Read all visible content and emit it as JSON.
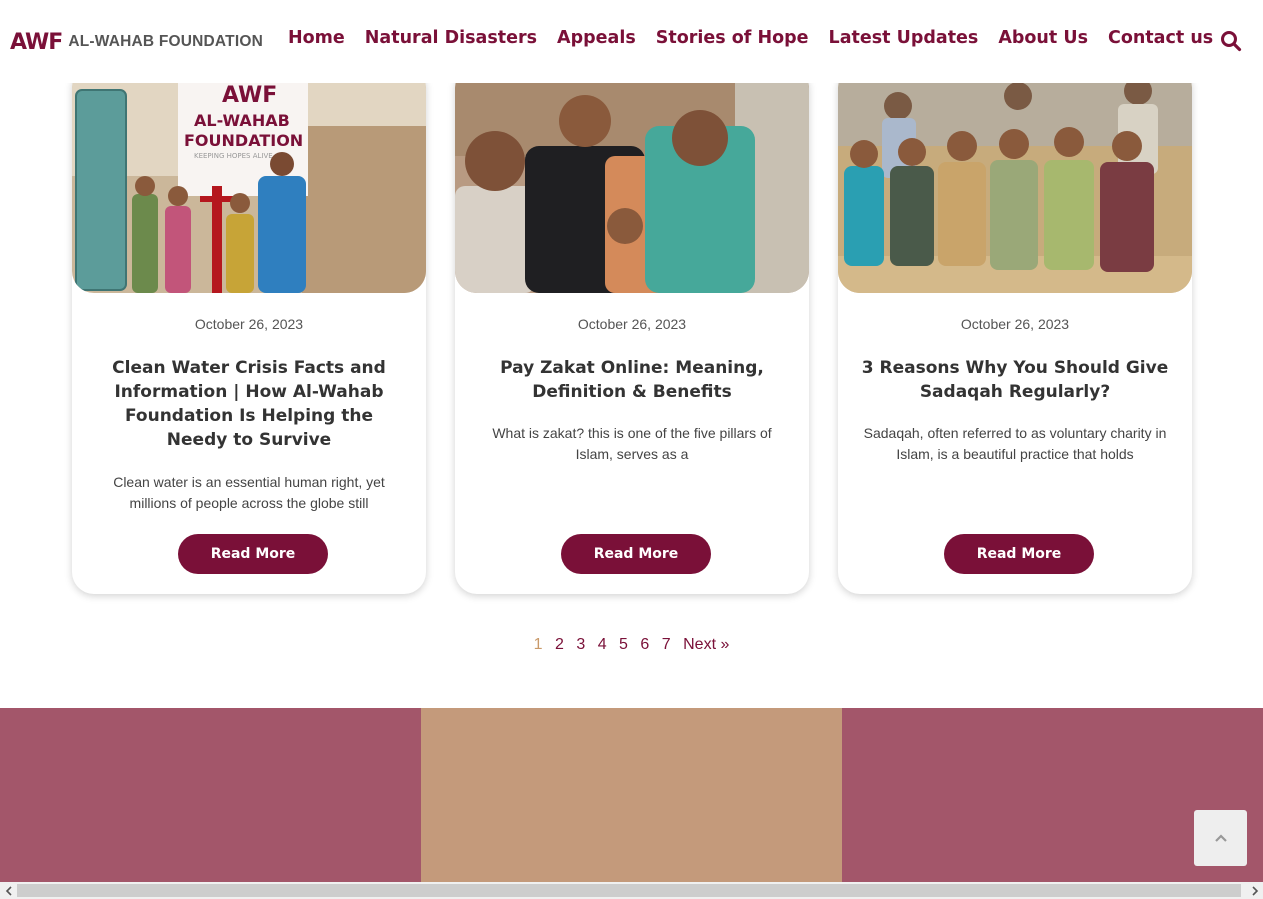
{
  "header": {
    "logo_mark": "AWF",
    "logo_text": "AL-WAHAB FOUNDATION",
    "nav": [
      {
        "label": "Home"
      },
      {
        "label": "Natural Disasters"
      },
      {
        "label": "Appeals"
      },
      {
        "label": "Stories of Hope"
      },
      {
        "label": "Latest Updates"
      },
      {
        "label": "About Us"
      },
      {
        "label": "Contact us"
      }
    ],
    "search_icon": "search-icon"
  },
  "cards": [
    {
      "date": "October 26, 2023",
      "title": "Clean Water Crisis Facts and Information | How Al-Wahab Foundation Is Helping the Needy to Survive",
      "excerpt": "Clean water is an essential human right, yet millions of people across the globe still",
      "button": "Read More",
      "image_banner_logo": "AWF",
      "image_banner_line1": "AL-WAHAB",
      "image_banner_line2": "FOUNDATION",
      "image_banner_line3": "KEEPING HOPES ALIVE"
    },
    {
      "date": "October 26, 2023",
      "title": "Pay Zakat Online: Meaning, Definition & Benefits",
      "excerpt": "What is zakat? this is one of the five pillars of Islam, serves as a",
      "button": "Read More"
    },
    {
      "date": "October 26, 2023",
      "title": "3 Reasons Why You Should Give Sadaqah Regularly?",
      "excerpt": "Sadaqah, often referred to as voluntary charity in Islam, is a beautiful practice that holds",
      "button": "Read More"
    }
  ],
  "pagination": {
    "current": "1",
    "pages": [
      "2",
      "3",
      "4",
      "5",
      "6",
      "7"
    ],
    "next": "Next »"
  },
  "footer_colors": [
    "#a3566a",
    "#c49a7b",
    "#a3566a"
  ],
  "colors": {
    "brand": "#7a1038",
    "accent": "#c99a6a"
  }
}
